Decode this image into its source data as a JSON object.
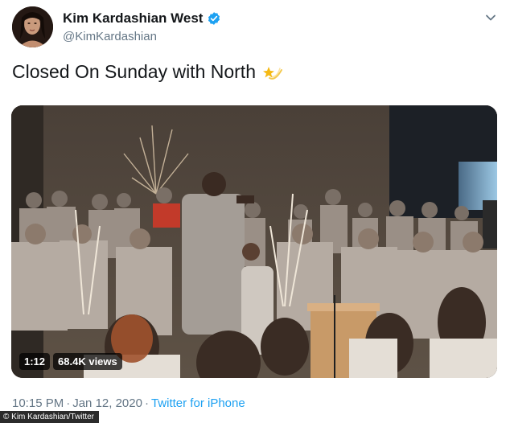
{
  "tweet": {
    "display_name": "Kim Kardashian West",
    "handle": "@KimKardashian",
    "text": "Closed On Sunday with North",
    "emoji_icon": "shooting-star-icon",
    "verified_color": "#1da1f2",
    "media": {
      "duration": "1:12",
      "views": "68.4K views"
    },
    "time": "10:15 PM",
    "separator": "·",
    "date": "Jan 12, 2020",
    "source": "Twitter for iPhone"
  },
  "credit": "© Kim Kardashian/Twitter"
}
